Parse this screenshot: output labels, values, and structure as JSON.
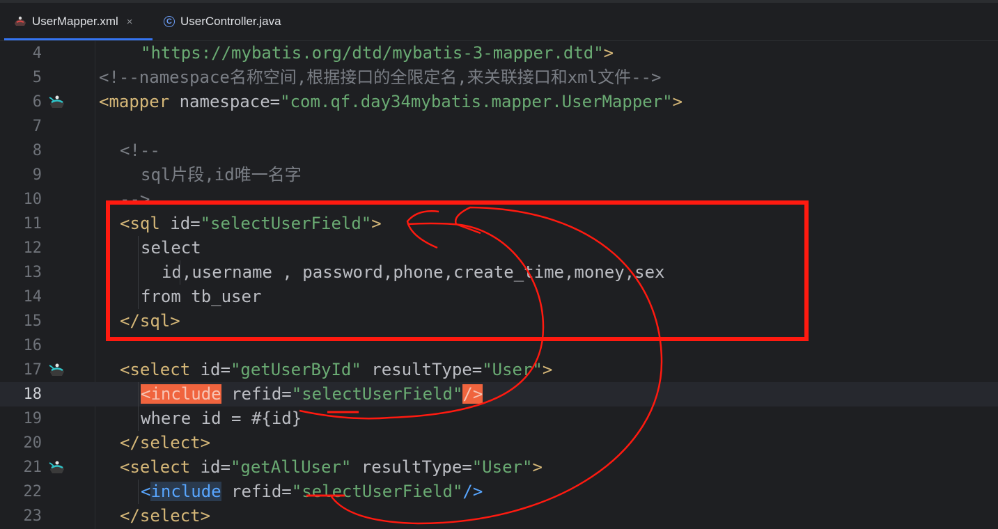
{
  "tabs": [
    {
      "label": "UserMapper.xml",
      "active": true,
      "icon": "ibatis-icon",
      "closable": true,
      "close_glyph": "×"
    },
    {
      "label": "UserController.java",
      "active": false,
      "icon": "java-class-icon",
      "class_glyph": "C"
    }
  ],
  "editor": {
    "current_line": 18,
    "lines": [
      {
        "num": "4",
        "gutter_icon": null,
        "indent": 4,
        "tokens": [
          {
            "t": "str",
            "v": "\"https://mybatis.org/dtd/mybatis-3-mapper.dtd\""
          },
          {
            "t": "tag",
            "v": ">"
          }
        ]
      },
      {
        "num": "5",
        "gutter_icon": null,
        "indent": 0,
        "tokens": [
          {
            "t": "comment",
            "v": "<!--namespace名称空间,根据接口的全限定名,来关联接口和xml文件-->"
          }
        ]
      },
      {
        "num": "6",
        "gutter_icon": "mybatis-mapper-icon",
        "indent": 0,
        "tokens": [
          {
            "t": "tag",
            "v": "<mapper "
          },
          {
            "t": "attr",
            "v": "namespace="
          },
          {
            "t": "str",
            "v": "\"com.qf.day34mybatis.mapper.UserMapper\""
          },
          {
            "t": "tag",
            "v": ">"
          }
        ]
      },
      {
        "num": "7",
        "gutter_icon": null,
        "indent": 0,
        "tokens": []
      },
      {
        "num": "8",
        "gutter_icon": null,
        "indent": 2,
        "tokens": [
          {
            "t": "comment",
            "v": "<!--"
          }
        ]
      },
      {
        "num": "9",
        "gutter_icon": null,
        "indent": 4,
        "tokens": [
          {
            "t": "comment",
            "v": "sql片段,id唯一名字"
          }
        ]
      },
      {
        "num": "10",
        "gutter_icon": null,
        "indent": 2,
        "tokens": [
          {
            "t": "comment",
            "v": "-->"
          }
        ]
      },
      {
        "num": "11",
        "gutter_icon": null,
        "indent": 2,
        "tokens": [
          {
            "t": "tag",
            "v": "<sql "
          },
          {
            "t": "attr",
            "v": "id="
          },
          {
            "t": "str",
            "v": "\"selectUserField\""
          },
          {
            "t": "tag",
            "v": ">"
          }
        ]
      },
      {
        "num": "12",
        "gutter_icon": null,
        "indent": 4,
        "tokens": [
          {
            "t": "plain",
            "v": "select"
          }
        ]
      },
      {
        "num": "13",
        "gutter_icon": null,
        "indent": 6,
        "tokens": [
          {
            "t": "plain",
            "v": "id,username , password,phone,create_time,money,sex"
          }
        ]
      },
      {
        "num": "14",
        "gutter_icon": null,
        "indent": 4,
        "tokens": [
          {
            "t": "plain",
            "v": "from tb_user"
          }
        ]
      },
      {
        "num": "15",
        "gutter_icon": null,
        "indent": 2,
        "tokens": [
          {
            "t": "tag",
            "v": "</sql>"
          }
        ]
      },
      {
        "num": "16",
        "gutter_icon": null,
        "indent": 0,
        "tokens": []
      },
      {
        "num": "17",
        "gutter_icon": "mybatis-mapper-icon",
        "indent": 2,
        "tokens": [
          {
            "t": "tag",
            "v": "<select "
          },
          {
            "t": "attr",
            "v": "id="
          },
          {
            "t": "str",
            "v": "\"getUserById\""
          },
          {
            "t": "attr",
            "v": " resultType="
          },
          {
            "t": "str",
            "v": "\"User\""
          },
          {
            "t": "tag",
            "v": ">"
          }
        ]
      },
      {
        "num": "18",
        "gutter_icon": null,
        "indent": 4,
        "tokens": [
          {
            "t": "hlred",
            "v": "<include"
          },
          {
            "t": "attr",
            "v": " refid="
          },
          {
            "t": "str",
            "v": "\"selectUserField\""
          },
          {
            "t": "hlred",
            "v": "/>"
          }
        ]
      },
      {
        "num": "19",
        "gutter_icon": null,
        "indent": 4,
        "tokens": [
          {
            "t": "plain",
            "v": "where id = #{id}"
          }
        ]
      },
      {
        "num": "20",
        "gutter_icon": null,
        "indent": 2,
        "tokens": [
          {
            "t": "tag",
            "v": "</select>"
          }
        ]
      },
      {
        "num": "21",
        "gutter_icon": "mybatis-mapper-icon",
        "indent": 2,
        "tokens": [
          {
            "t": "tag",
            "v": "<select "
          },
          {
            "t": "attr",
            "v": "id="
          },
          {
            "t": "str",
            "v": "\"getAllUser\""
          },
          {
            "t": "attr",
            "v": " resultType="
          },
          {
            "t": "str",
            "v": "\"User\""
          },
          {
            "t": "tag",
            "v": ">"
          }
        ]
      },
      {
        "num": "22",
        "gutter_icon": null,
        "indent": 4,
        "tokens": [
          {
            "t": "blue",
            "v": "<"
          },
          {
            "t": "hlblue",
            "v": "include"
          },
          {
            "t": "attr",
            "v": " refid="
          },
          {
            "t": "str",
            "v": "\"selectUserField\""
          },
          {
            "t": "blue",
            "v": "/>"
          }
        ]
      },
      {
        "num": "23",
        "gutter_icon": null,
        "indent": 2,
        "tokens": [
          {
            "t": "tag",
            "v": "</select>"
          }
        ]
      }
    ]
  },
  "colors": {
    "background": "#1e1f22",
    "tag": "#d5b778",
    "string": "#6aab73",
    "comment": "#7a7e85",
    "plain": "#bcbec4",
    "annotation": "#ff1a10",
    "include_highlight": "#f0643e",
    "active_tab_underline": "#3574f0"
  }
}
